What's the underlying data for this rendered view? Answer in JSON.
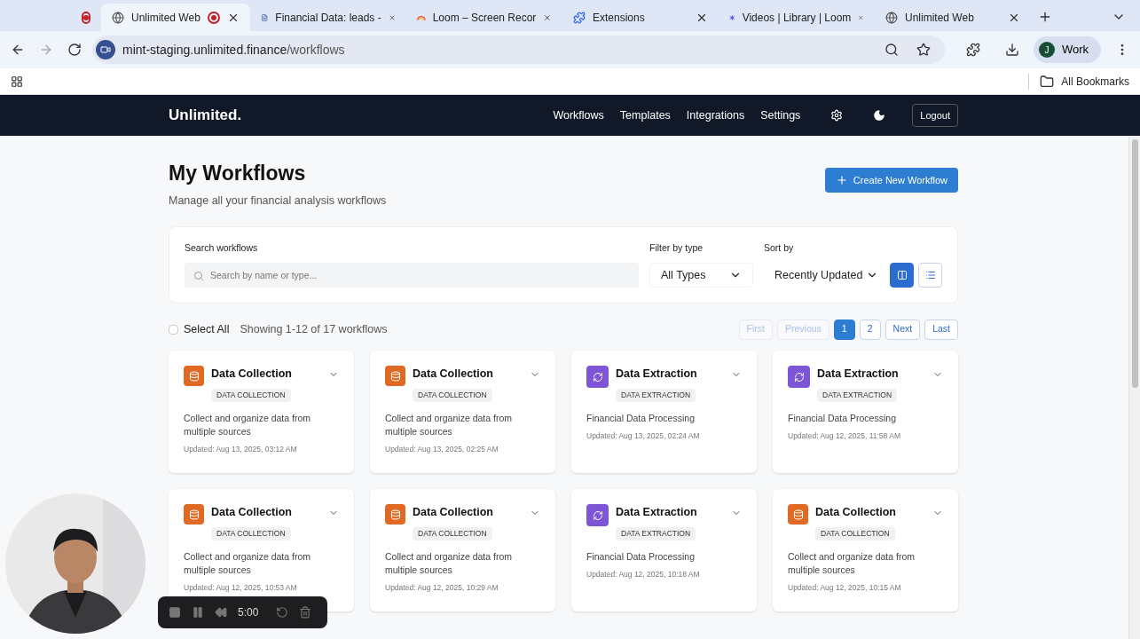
{
  "browser": {
    "tabs": [
      {
        "kind": "record",
        "selected": false,
        "recording": false
      },
      {
        "kind": "globe",
        "title": "Unlimited Web",
        "selected": true,
        "recording": true
      },
      {
        "kind": "doc",
        "title": "Financial Data: leads -",
        "selected": false,
        "recording": false
      },
      {
        "kind": "rainbow",
        "title": "Loom – Screen Recor",
        "selected": false,
        "recording": false
      },
      {
        "kind": "puzzle",
        "title": "Extensions",
        "selected": false,
        "recording": false
      },
      {
        "kind": "star",
        "title": "Videos | Library | Loom",
        "selected": false,
        "recording": false
      },
      {
        "kind": "globe",
        "title": "Unlimited Web",
        "selected": false,
        "recording": false
      }
    ],
    "address_host": "mint-staging.unlimited.finance",
    "address_path": "/workflows",
    "profile_initial": "J",
    "profile_label": "Work",
    "bookmarks": "All Bookmarks"
  },
  "nav": {
    "brand": "Unlimited.",
    "links": [
      "Workflows",
      "Templates",
      "Integrations",
      "Settings"
    ],
    "logout": "Logout"
  },
  "page": {
    "title": "My Workflows",
    "subtitle": "Manage all your financial analysis workflows",
    "create_button": "Create New Workflow"
  },
  "filters": {
    "search_label": "Search workflows",
    "search_placeholder": "Search by name or type...",
    "filter_label": "Filter by type",
    "filter_value": "All Types",
    "sort_label": "Sort by",
    "sort_value": "Recently Updated",
    "views": [
      {
        "kind": "grid",
        "selected": true
      },
      {
        "kind": "list",
        "selected": false
      }
    ]
  },
  "select_all": {
    "label": "Select All",
    "checked": false
  },
  "showing": "Showing 1-12 of 17 workflows",
  "pagination": [
    {
      "label": "First",
      "disabled": true,
      "selected": false
    },
    {
      "label": "Previous",
      "disabled": true,
      "selected": false
    },
    {
      "label": "1",
      "disabled": false,
      "selected": true
    },
    {
      "label": "2",
      "disabled": false,
      "selected": false
    },
    {
      "label": "Next",
      "disabled": false,
      "selected": false
    },
    {
      "label": "Last",
      "disabled": false,
      "selected": false
    }
  ],
  "cards": [
    {
      "kind": "collection",
      "title": "Data Collection",
      "tag": "DATA COLLECTION",
      "description": "Collect and organize data from multiple sources",
      "updated": "Updated: Aug 13, 2025, 03:12 AM"
    },
    {
      "kind": "collection",
      "title": "Data Collection",
      "tag": "DATA COLLECTION",
      "description": "Collect and organize data from multiple sources",
      "updated": "Updated: Aug 13, 2025, 02:25 AM"
    },
    {
      "kind": "extraction",
      "title": "Data Extraction",
      "tag": "DATA EXTRACTION",
      "description": "Financial Data Processing",
      "updated": "Updated: Aug 13, 2025, 02:24 AM"
    },
    {
      "kind": "extraction",
      "title": "Data Extraction",
      "tag": "DATA EXTRACTION",
      "description": "Financial Data Processing",
      "updated": "Updated: Aug 12, 2025, 11:58 AM"
    },
    {
      "kind": "collection",
      "title": "Data Collection",
      "tag": "DATA COLLECTION",
      "description": "Collect and organize data from multiple sources",
      "updated": "Updated: Aug 12, 2025, 10:53 AM"
    },
    {
      "kind": "collection",
      "title": "Data Collection",
      "tag": "DATA COLLECTION",
      "description": "Collect and organize data from multiple sources",
      "updated": "Updated: Aug 12, 2025, 10:29 AM"
    },
    {
      "kind": "extraction",
      "title": "Data Extraction",
      "tag": "DATA EXTRACTION",
      "description": "Financial Data Processing",
      "updated": "Updated: Aug 12, 2025, 10:18 AM"
    },
    {
      "kind": "collection",
      "title": "Data Collection",
      "tag": "DATA COLLECTION",
      "description": "Collect and organize data from multiple sources",
      "updated": "Updated: Aug 12, 2025, 10:15 AM"
    }
  ],
  "recorder": {
    "timer": "5:00"
  }
}
